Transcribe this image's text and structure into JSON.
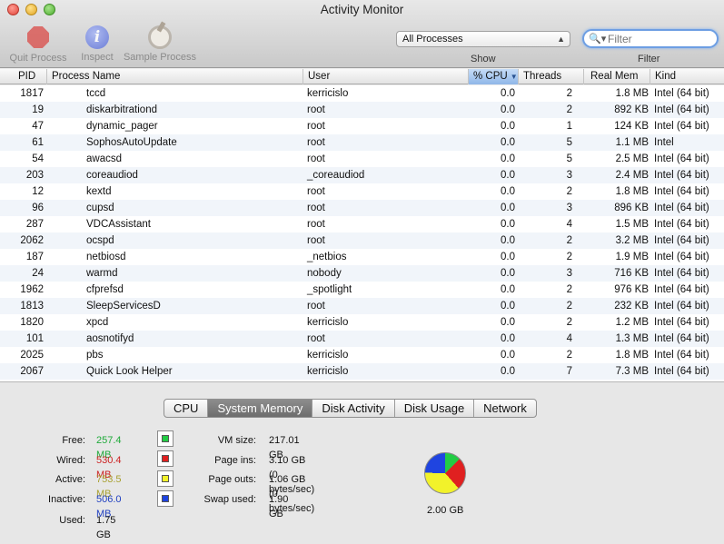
{
  "window": {
    "title": "Activity Monitor"
  },
  "toolbar": {
    "quit_label": "Quit Process",
    "inspect_label": "Inspect",
    "sample_label": "Sample Process",
    "show_select_value": "All Processes",
    "show_label": "Show",
    "filter_placeholder": "Filter",
    "filter_label": "Filter"
  },
  "table": {
    "columns": {
      "pid": "PID",
      "name": "Process Name",
      "user": "User",
      "cpu": "% CPU",
      "threads": "Threads",
      "real_mem": "Real Mem",
      "kind": "Kind"
    },
    "sort_column": "cpu",
    "rows": [
      {
        "pid": "1817",
        "name": "tccd",
        "user": "kerricislo",
        "cpu": "0.0",
        "threads": "2",
        "mem": "1.8 MB",
        "kind": "Intel (64 bit)"
      },
      {
        "pid": "19",
        "name": "diskarbitrationd",
        "user": "root",
        "cpu": "0.0",
        "threads": "2",
        "mem": "892 KB",
        "kind": "Intel (64 bit)"
      },
      {
        "pid": "47",
        "name": "dynamic_pager",
        "user": "root",
        "cpu": "0.0",
        "threads": "1",
        "mem": "124 KB",
        "kind": "Intel (64 bit)"
      },
      {
        "pid": "61",
        "name": "SophosAutoUpdate",
        "user": "root",
        "cpu": "0.0",
        "threads": "5",
        "mem": "1.1 MB",
        "kind": "Intel"
      },
      {
        "pid": "54",
        "name": "awacsd",
        "user": "root",
        "cpu": "0.0",
        "threads": "5",
        "mem": "2.5 MB",
        "kind": "Intel (64 bit)"
      },
      {
        "pid": "203",
        "name": "coreaudiod",
        "user": "_coreaudiod",
        "cpu": "0.0",
        "threads": "3",
        "mem": "2.4 MB",
        "kind": "Intel (64 bit)"
      },
      {
        "pid": "12",
        "name": "kextd",
        "user": "root",
        "cpu": "0.0",
        "threads": "2",
        "mem": "1.8 MB",
        "kind": "Intel (64 bit)"
      },
      {
        "pid": "96",
        "name": "cupsd",
        "user": "root",
        "cpu": "0.0",
        "threads": "3",
        "mem": "896 KB",
        "kind": "Intel (64 bit)"
      },
      {
        "pid": "287",
        "name": "VDCAssistant",
        "user": "root",
        "cpu": "0.0",
        "threads": "4",
        "mem": "1.5 MB",
        "kind": "Intel (64 bit)"
      },
      {
        "pid": "2062",
        "name": "ocspd",
        "user": "root",
        "cpu": "0.0",
        "threads": "2",
        "mem": "3.2 MB",
        "kind": "Intel (64 bit)"
      },
      {
        "pid": "187",
        "name": "netbiosd",
        "user": "_netbios",
        "cpu": "0.0",
        "threads": "2",
        "mem": "1.9 MB",
        "kind": "Intel (64 bit)"
      },
      {
        "pid": "24",
        "name": "warmd",
        "user": "nobody",
        "cpu": "0.0",
        "threads": "3",
        "mem": "716 KB",
        "kind": "Intel (64 bit)"
      },
      {
        "pid": "1962",
        "name": "cfprefsd",
        "user": "_spotlight",
        "cpu": "0.0",
        "threads": "2",
        "mem": "976 KB",
        "kind": "Intel (64 bit)"
      },
      {
        "pid": "1813",
        "name": "SleepServicesD",
        "user": "root",
        "cpu": "0.0",
        "threads": "2",
        "mem": "232 KB",
        "kind": "Intel (64 bit)"
      },
      {
        "pid": "1820",
        "name": "xpcd",
        "user": "kerricislo",
        "cpu": "0.0",
        "threads": "2",
        "mem": "1.2 MB",
        "kind": "Intel (64 bit)"
      },
      {
        "pid": "101",
        "name": "aosnotifyd",
        "user": "root",
        "cpu": "0.0",
        "threads": "4",
        "mem": "1.3 MB",
        "kind": "Intel (64 bit)"
      },
      {
        "pid": "2025",
        "name": "pbs",
        "user": "kerricislo",
        "cpu": "0.0",
        "threads": "2",
        "mem": "1.8 MB",
        "kind": "Intel (64 bit)"
      },
      {
        "pid": "2067",
        "name": "Quick Look Helper",
        "user": "kerricislo",
        "cpu": "0.0",
        "threads": "7",
        "mem": "7.3 MB",
        "kind": "Intel (64 bit)"
      }
    ]
  },
  "tabs": [
    {
      "label": "CPU"
    },
    {
      "label": "System Memory",
      "active": true
    },
    {
      "label": "Disk Activity"
    },
    {
      "label": "Disk Usage"
    },
    {
      "label": "Network"
    }
  ],
  "memory": {
    "free": {
      "label": "Free:",
      "value": "257.4 MB",
      "color": "#1faa3a"
    },
    "wired": {
      "label": "Wired:",
      "value": "530.4 MB",
      "color": "#cc2222"
    },
    "active": {
      "label": "Active:",
      "value": "753.5 MB",
      "color": "#a8a030"
    },
    "inactive": {
      "label": "Inactive:",
      "value": "506.0 MB",
      "color": "#2040c0"
    },
    "used": {
      "label": "Used:",
      "value": "1.75 GB"
    },
    "swatch_colors": {
      "free": "#22cc44",
      "wired": "#e02020",
      "active": "#f2f22a",
      "inactive": "#1f44e0"
    },
    "vm_size": {
      "label": "VM size:",
      "value": "217.01 GB"
    },
    "page_ins": {
      "label": "Page ins:",
      "value": "3.10 GB (0 bytes/sec)"
    },
    "page_outs": {
      "label": "Page outs:",
      "value": "1.06 GB (0 bytes/sec)"
    },
    "swap_used": {
      "label": "Swap used:",
      "value": "1.90 GB"
    },
    "total": "2.00 GB"
  }
}
